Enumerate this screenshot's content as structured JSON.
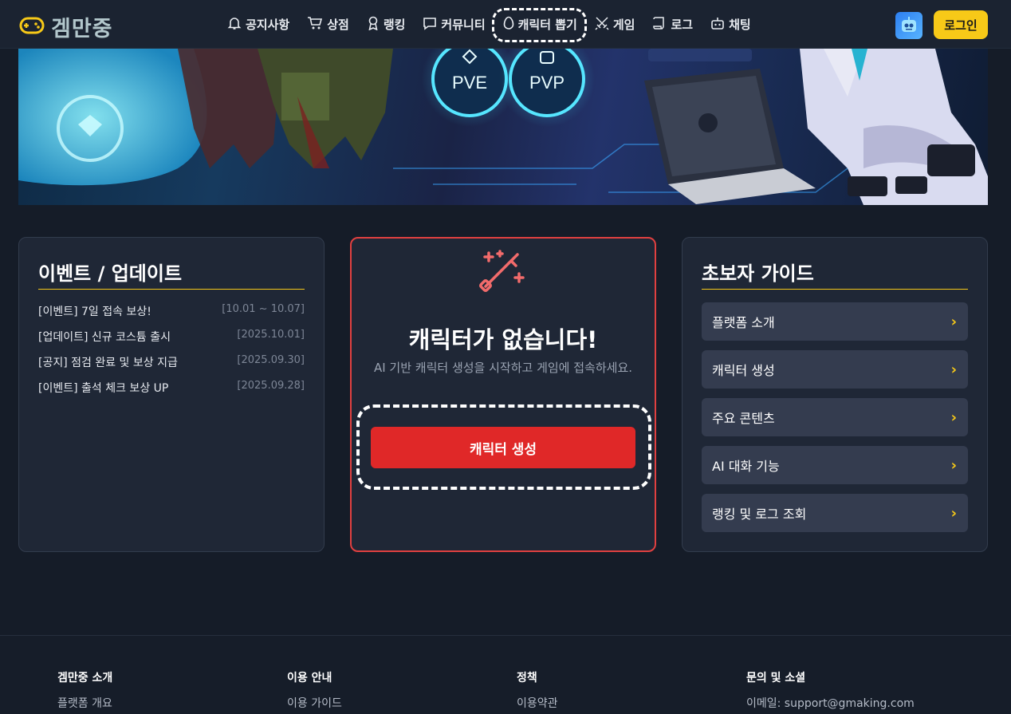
{
  "brand": {
    "name": "겜만중"
  },
  "nav": {
    "items": [
      {
        "label": "공지사항",
        "icon": "bell-icon"
      },
      {
        "label": "상점",
        "icon": "cart-icon"
      },
      {
        "label": "랭킹",
        "icon": "medal-icon"
      },
      {
        "label": "커뮤니티",
        "icon": "chat-icon"
      },
      {
        "label": "캐릭터 뽑기",
        "icon": "egg-icon"
      },
      {
        "label": "게임",
        "icon": "swords-icon"
      },
      {
        "label": "로그",
        "icon": "scroll-icon"
      },
      {
        "label": "채팅",
        "icon": "bot-icon"
      }
    ],
    "login": "로그인"
  },
  "banner": {
    "badges": [
      "PVE",
      "PVP"
    ]
  },
  "events": {
    "title": "이벤트 / 업데이트",
    "items": [
      {
        "title": "[이벤트] 7일 접속 보상!",
        "date": "[10.01 ~ 10.07]"
      },
      {
        "title": "[업데이트] 신규 코스튬 출시",
        "date": "[2025.10.01]"
      },
      {
        "title": "[공지] 점검 완료 및 보상 지급",
        "date": "[2025.09.30]"
      },
      {
        "title": "[이벤트] 출석 체크 보상 UP",
        "date": "[2025.09.28]"
      }
    ]
  },
  "character": {
    "title": "캐릭터가 없습니다!",
    "desc": "AI 기반 캐릭터 생성을 시작하고 게임에 접속하세요.",
    "button": "캐릭터 생성"
  },
  "guide": {
    "title": "초보자 가이드",
    "items": [
      "플랫폼 소개",
      "캐릭터 생성",
      "주요 콘텐츠",
      "AI 대화 기능",
      "랭킹 및 로그 조회"
    ]
  },
  "footer": {
    "columns": [
      {
        "heading": "겜만중 소개",
        "link": "플랫폼 개요"
      },
      {
        "heading": "이용 안내",
        "link": "이용 가이드"
      },
      {
        "heading": "정책",
        "link": "이용약관"
      },
      {
        "heading": "문의 및 소셜",
        "link": "이메일: support@gmaking.com"
      }
    ]
  },
  "colors": {
    "accent": "#f7c918",
    "danger": "#e02828",
    "bg": "#151c28",
    "card": "#1f2736"
  }
}
